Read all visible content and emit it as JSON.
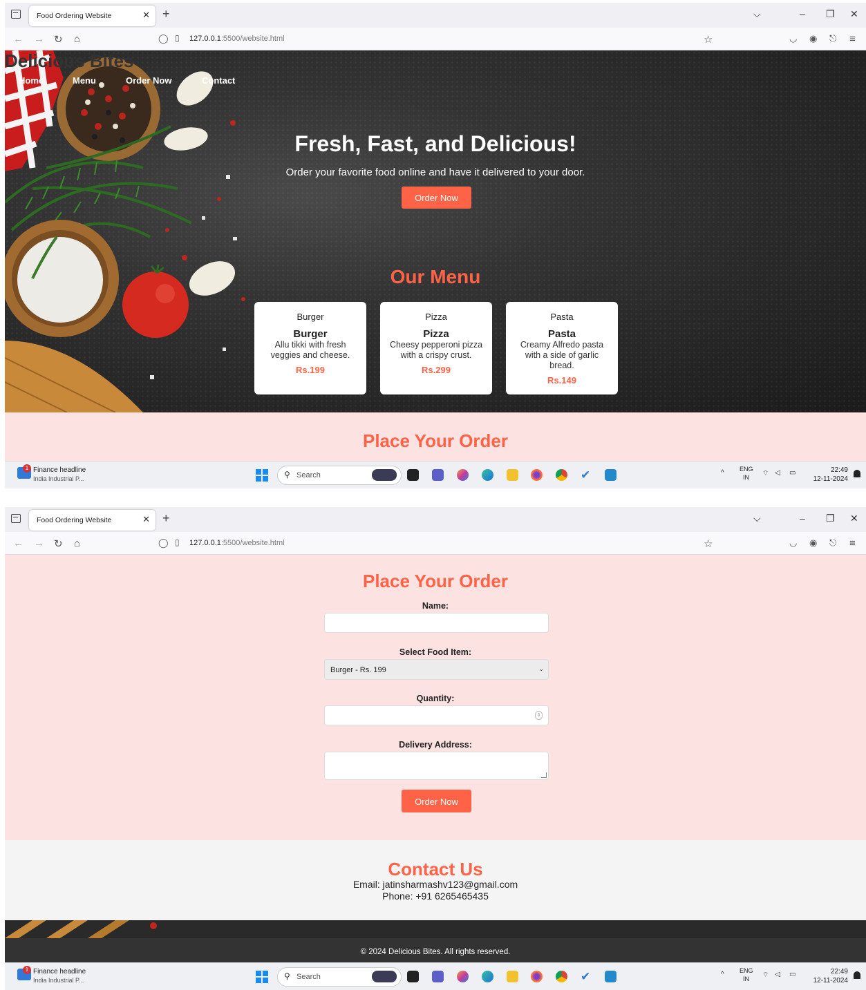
{
  "browser": {
    "tab_title": "Food Ordering Website",
    "url_host": "127.0.0.1",
    "url_path": ":5500/website.html"
  },
  "site": {
    "logo": "Delicious Bites",
    "nav": [
      "Home",
      "Menu",
      "Order Now",
      "Contact"
    ]
  },
  "hero": {
    "title": "Fresh, Fast, and Delicious!",
    "subtitle": "Order your favorite food online and have it delivered to your door.",
    "button": "Order Now"
  },
  "menu": {
    "title": "Our Menu",
    "items": [
      {
        "img_alt": "Burger",
        "name": "Burger",
        "desc": "Allu tikki with fresh veggies and cheese.",
        "price": "Rs.199"
      },
      {
        "img_alt": "Pizza",
        "name": "Pizza",
        "desc": "Cheesy pepperoni pizza with a crispy crust.",
        "price": "Rs.299"
      },
      {
        "img_alt": "Pasta",
        "name": "Pasta",
        "desc": "Creamy Alfredo pasta with a side of garlic bread.",
        "price": "Rs.149"
      }
    ]
  },
  "order": {
    "title": "Place Your Order",
    "name_label": "Name:",
    "name_value": "",
    "food_label": "Select Food Item:",
    "food_selected": "Burger - Rs. 199",
    "qty_label": "Quantity:",
    "qty_value": "",
    "address_label": "Delivery Address:",
    "address_value": "",
    "button": "Order Now"
  },
  "contact": {
    "title": "Contact Us",
    "email": "Email: jatinsharmashv123@gmail.com",
    "phone": "Phone: +91 6265465435"
  },
  "footer": {
    "text": "© 2024 Delicious Bites. All rights reserved."
  },
  "taskbar": {
    "news_count": "1",
    "news_title": "Finance headline",
    "news_sub": "India Industrial P...",
    "search": "Search",
    "lang_top": "ENG",
    "lang_bottom": "IN",
    "time": "22:49",
    "date": "12-11-2024"
  },
  "colors": {
    "accent": "#ff6347",
    "order_bg": "#fde2e2",
    "footer_bg": "#333333"
  }
}
